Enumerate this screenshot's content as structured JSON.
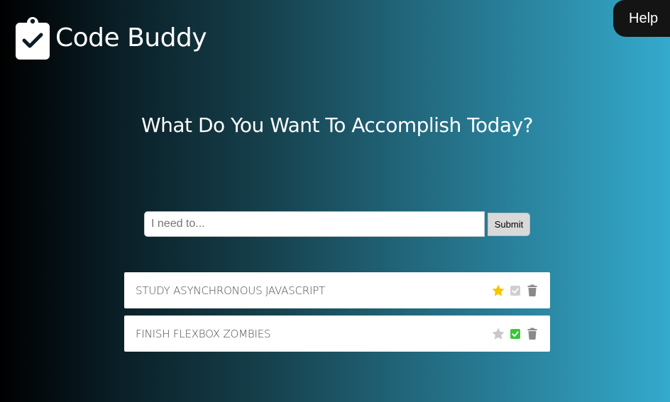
{
  "header": {
    "brand_title": "Code Buddy",
    "brand_icon": "clipboard-check-icon",
    "help_label": "Help"
  },
  "main": {
    "headline": "What Do You Want To Accomplish Today?"
  },
  "form": {
    "input_placeholder": "I need to...",
    "input_value": "",
    "submit_label": "Submit"
  },
  "tasks": [
    {
      "text": "STUDY ASYNCHRONOUS JAVASCRIPT",
      "starred": true,
      "completed": false
    },
    {
      "text": "FINISH FLEXBOX ZOMBIES",
      "starred": false,
      "completed": true
    }
  ],
  "colors": {
    "star_active": "#f7c500",
    "star_inactive": "#c8c8c8",
    "check_completed": "#3cc43c",
    "check_pending": "#cfcfcf",
    "trash": "#8a8a8a"
  }
}
